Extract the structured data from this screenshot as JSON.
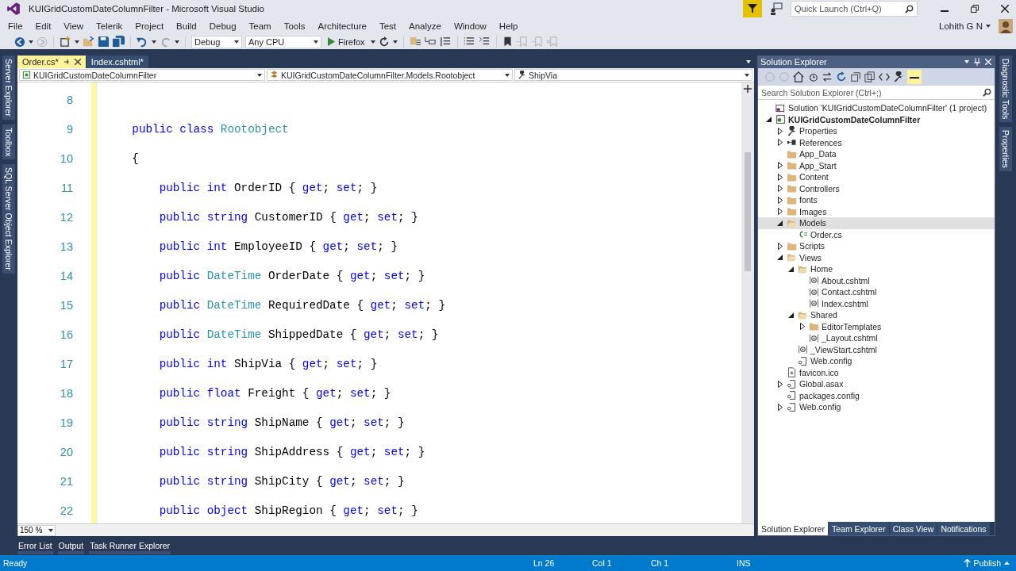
{
  "window": {
    "title": "KUIGridCustomDateColumnFilter - Microsoft Visual Studio",
    "quick_launch": {
      "placeholder": "Quick Launch (Ctrl+Q)"
    },
    "user": "Lohith G N"
  },
  "menu": [
    "File",
    "Edit",
    "View",
    "Telerik",
    "Project",
    "Build",
    "Debug",
    "Team",
    "Tools",
    "Architecture",
    "Test",
    "Analyze",
    "Window",
    "Help"
  ],
  "toolbar": {
    "configuration": "Debug",
    "platform": "Any CPU",
    "run_target": "Firefox"
  },
  "left_tabs": [
    "Server Explorer",
    "Toolbox",
    "SQL Server Object Explorer"
  ],
  "document_tabs": [
    {
      "label": "Order.cs*",
      "selected": true
    },
    {
      "label": "Index.cshtml*",
      "selected": false
    }
  ],
  "navigation": [
    "KUIGridCustomDateColumnFilter",
    "KUIGridCustomDateColumnFilter.Models.Rootobject",
    "ShipVia"
  ],
  "code_lines": [
    {
      "number": "8",
      "kind": "blank"
    },
    {
      "number": "9",
      "kind": "class",
      "tokens": [
        {
          "text": "public class ",
          "kind": "keyword"
        },
        {
          "text": "Rootobject",
          "kind": "type"
        }
      ]
    },
    {
      "number": "10",
      "kind": "class",
      "tokens": [
        {
          "text": "{",
          "kind": "plain"
        }
      ]
    },
    {
      "number": "11",
      "kind": "member",
      "tokens": [
        {
          "text": "public int",
          "kind": "keyword"
        },
        {
          "text": " OrderID { ",
          "kind": "plain"
        },
        {
          "text": "get",
          "kind": "keyword"
        },
        {
          "text": "; ",
          "kind": "plain"
        },
        {
          "text": "set",
          "kind": "keyword"
        },
        {
          "text": "; }",
          "kind": "plain"
        }
      ]
    },
    {
      "number": "12",
      "kind": "member",
      "tokens": [
        {
          "text": "public string",
          "kind": "keyword"
        },
        {
          "text": " CustomerID { ",
          "kind": "plain"
        },
        {
          "text": "get",
          "kind": "keyword"
        },
        {
          "text": "; ",
          "kind": "plain"
        },
        {
          "text": "set",
          "kind": "keyword"
        },
        {
          "text": "; }",
          "kind": "plain"
        }
      ]
    },
    {
      "number": "13",
      "kind": "member",
      "tokens": [
        {
          "text": "public int",
          "kind": "keyword"
        },
        {
          "text": " EmployeeID { ",
          "kind": "plain"
        },
        {
          "text": "get",
          "kind": "keyword"
        },
        {
          "text": "; ",
          "kind": "plain"
        },
        {
          "text": "set",
          "kind": "keyword"
        },
        {
          "text": "; }",
          "kind": "plain"
        }
      ]
    },
    {
      "number": "14",
      "kind": "member",
      "tokens": [
        {
          "text": "public ",
          "kind": "keyword"
        },
        {
          "text": "DateTime",
          "kind": "type"
        },
        {
          "text": " OrderDate { ",
          "kind": "plain"
        },
        {
          "text": "get",
          "kind": "keyword"
        },
        {
          "text": "; ",
          "kind": "plain"
        },
        {
          "text": "set",
          "kind": "keyword"
        },
        {
          "text": "; }",
          "kind": "plain"
        }
      ]
    },
    {
      "number": "15",
      "kind": "member",
      "tokens": [
        {
          "text": "public ",
          "kind": "keyword"
        },
        {
          "text": "DateTime",
          "kind": "type"
        },
        {
          "text": " RequiredDate { ",
          "kind": "plain"
        },
        {
          "text": "get",
          "kind": "keyword"
        },
        {
          "text": "; ",
          "kind": "plain"
        },
        {
          "text": "set",
          "kind": "keyword"
        },
        {
          "text": "; }",
          "kind": "plain"
        }
      ]
    },
    {
      "number": "16",
      "kind": "member",
      "tokens": [
        {
          "text": "public ",
          "kind": "keyword"
        },
        {
          "text": "DateTime",
          "kind": "type"
        },
        {
          "text": " ShippedDate { ",
          "kind": "plain"
        },
        {
          "text": "get",
          "kind": "keyword"
        },
        {
          "text": "; ",
          "kind": "plain"
        },
        {
          "text": "set",
          "kind": "keyword"
        },
        {
          "text": "; }",
          "kind": "plain"
        }
      ]
    },
    {
      "number": "17",
      "kind": "member",
      "tokens": [
        {
          "text": "public int",
          "kind": "keyword"
        },
        {
          "text": " ShipVia { ",
          "kind": "plain"
        },
        {
          "text": "get",
          "kind": "keyword"
        },
        {
          "text": "; ",
          "kind": "plain"
        },
        {
          "text": "set",
          "kind": "keyword"
        },
        {
          "text": "; }",
          "kind": "plain"
        }
      ]
    },
    {
      "number": "18",
      "kind": "member",
      "tokens": [
        {
          "text": "public float",
          "kind": "keyword"
        },
        {
          "text": " Freight { ",
          "kind": "plain"
        },
        {
          "text": "get",
          "kind": "keyword"
        },
        {
          "text": "; ",
          "kind": "plain"
        },
        {
          "text": "set",
          "kind": "keyword"
        },
        {
          "text": "; }",
          "kind": "plain"
        }
      ]
    },
    {
      "number": "19",
      "kind": "member",
      "tokens": [
        {
          "text": "public string",
          "kind": "keyword"
        },
        {
          "text": " ShipName { ",
          "kind": "plain"
        },
        {
          "text": "get",
          "kind": "keyword"
        },
        {
          "text": "; ",
          "kind": "plain"
        },
        {
          "text": "set",
          "kind": "keyword"
        },
        {
          "text": "; }",
          "kind": "plain"
        }
      ]
    },
    {
      "number": "20",
      "kind": "member",
      "tokens": [
        {
          "text": "public string",
          "kind": "keyword"
        },
        {
          "text": " ShipAddress { ",
          "kind": "plain"
        },
        {
          "text": "get",
          "kind": "keyword"
        },
        {
          "text": "; ",
          "kind": "plain"
        },
        {
          "text": "set",
          "kind": "keyword"
        },
        {
          "text": "; }",
          "kind": "plain"
        }
      ]
    },
    {
      "number": "21",
      "kind": "member",
      "tokens": [
        {
          "text": "public string",
          "kind": "keyword"
        },
        {
          "text": " ShipCity { ",
          "kind": "plain"
        },
        {
          "text": "get",
          "kind": "keyword"
        },
        {
          "text": "; ",
          "kind": "plain"
        },
        {
          "text": "set",
          "kind": "keyword"
        },
        {
          "text": "; }",
          "kind": "plain"
        }
      ]
    },
    {
      "number": "22",
      "kind": "member",
      "tokens": [
        {
          "text": "public object",
          "kind": "keyword"
        },
        {
          "text": " ShipRegion { ",
          "kind": "plain"
        },
        {
          "text": "get",
          "kind": "keyword"
        },
        {
          "text": "; ",
          "kind": "plain"
        },
        {
          "text": "set",
          "kind": "keyword"
        },
        {
          "text": "; }",
          "kind": "plain"
        }
      ]
    }
  ],
  "zoom": "150 %",
  "bottom_tabs": [
    "Error List",
    "Output",
    "Task Runner Explorer"
  ],
  "solution_explorer": {
    "title": "Solution Explorer",
    "search": {
      "placeholder": "Search Solution Explorer (Ctrl+;)"
    },
    "tree": [
      {
        "label": "Solution 'KUIGridCustomDateColumnFilter' (1 project)",
        "kind": "solution",
        "selected": false
      },
      {
        "label": "KUIGridCustomDateColumnFilter",
        "kind": "project",
        "expanded": true,
        "selected": false,
        "children": [
          {
            "label": "Properties",
            "kind": "wrench",
            "expanded": false,
            "selected": false
          },
          {
            "label": "References",
            "kind": "references",
            "expanded": false,
            "selected": false
          },
          {
            "label": "App_Data",
            "kind": "folder",
            "selected": false
          },
          {
            "label": "App_Start",
            "kind": "folder",
            "expanded": false,
            "selected": false
          },
          {
            "label": "Content",
            "kind": "folder",
            "expanded": false,
            "selected": false
          },
          {
            "label": "Controllers",
            "kind": "folder",
            "expanded": false,
            "selected": false
          },
          {
            "label": "fonts",
            "kind": "folder",
            "expanded": false,
            "selected": false
          },
          {
            "label": "Images",
            "kind": "folder",
            "expanded": false,
            "selected": false
          },
          {
            "label": "Models",
            "kind": "open-folder",
            "expanded": true,
            "selected": true,
            "children": [
              {
                "label": "Order.cs",
                "kind": "csharp",
                "selected": false
              }
            ]
          },
          {
            "label": "Scripts",
            "kind": "folder",
            "expanded": false,
            "selected": false
          },
          {
            "label": "Views",
            "kind": "open-folder",
            "expanded": true,
            "selected": false,
            "children": [
              {
                "label": "Home",
                "kind": "open-folder",
                "expanded": true,
                "selected": false,
                "children": [
                  {
                    "label": "About.cshtml",
                    "kind": "razor",
                    "selected": false
                  },
                  {
                    "label": "Contact.cshtml",
                    "kind": "razor",
                    "selected": false
                  },
                  {
                    "label": "Index.cshtml",
                    "kind": "razor",
                    "selected": false
                  }
                ]
              },
              {
                "label": "Shared",
                "kind": "open-folder",
                "expanded": true,
                "selected": false,
                "children": [
                  {
                    "label": "EditorTemplates",
                    "kind": "folder",
                    "expanded": false,
                    "selected": false
                  },
                  {
                    "label": "_Layout.cshtml",
                    "kind": "razor",
                    "selected": false
                  }
                ]
              },
              {
                "label": "_ViewStart.cshtml",
                "kind": "razor",
                "selected": false
              },
              {
                "label": "Web.config",
                "kind": "config",
                "selected": false
              }
            ]
          },
          {
            "label": "favicon.ico",
            "kind": "file",
            "selected": false
          },
          {
            "label": "Global.asax",
            "kind": "config",
            "expanded": false,
            "selected": false
          },
          {
            "label": "packages.config",
            "kind": "config",
            "selected": false
          },
          {
            "label": "Web.config",
            "kind": "config",
            "expanded": false,
            "selected": false
          }
        ]
      }
    ]
  },
  "panel_tabs": [
    {
      "label": "Solution Explorer",
      "selected": true
    },
    {
      "label": "Team Explorer",
      "selected": false
    },
    {
      "label": "Class View",
      "selected": false
    },
    {
      "label": "Notifications",
      "selected": false
    }
  ],
  "right_tabs": [
    "Diagnostic Tools",
    "Properties"
  ],
  "status_bar": {
    "message": "Ready",
    "line": "Ln 26",
    "column": "Col 1",
    "char": "Ch 1",
    "mode": "INS",
    "publish": "Publish"
  }
}
